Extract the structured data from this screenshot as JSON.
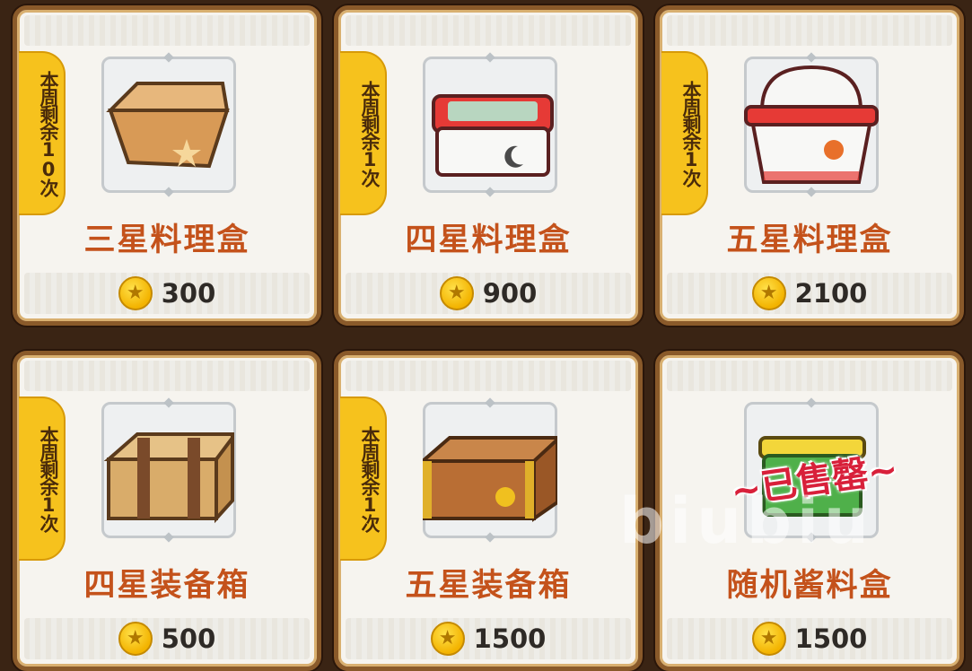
{
  "items": [
    {
      "name": "三星料理盒",
      "price": "300",
      "limit": "本周剩余10次"
    },
    {
      "name": "四星料理盒",
      "price": "900",
      "limit": "本周剩余1次"
    },
    {
      "name": "五星料理盒",
      "price": "2100",
      "limit": "本周剩余1次"
    },
    {
      "name": "四星装备箱",
      "price": "500",
      "limit": "本周剩余1次"
    },
    {
      "name": "五星装备箱",
      "price": "1500",
      "limit": "本周剩余1次"
    },
    {
      "name": "随机酱料盒",
      "price": "1500",
      "sold_out": "~已售罄~"
    }
  ],
  "watermark": "biubiu",
  "colors": {
    "name": "#c4521b",
    "badge": "#f6c21d",
    "sold": "#d8203a"
  }
}
